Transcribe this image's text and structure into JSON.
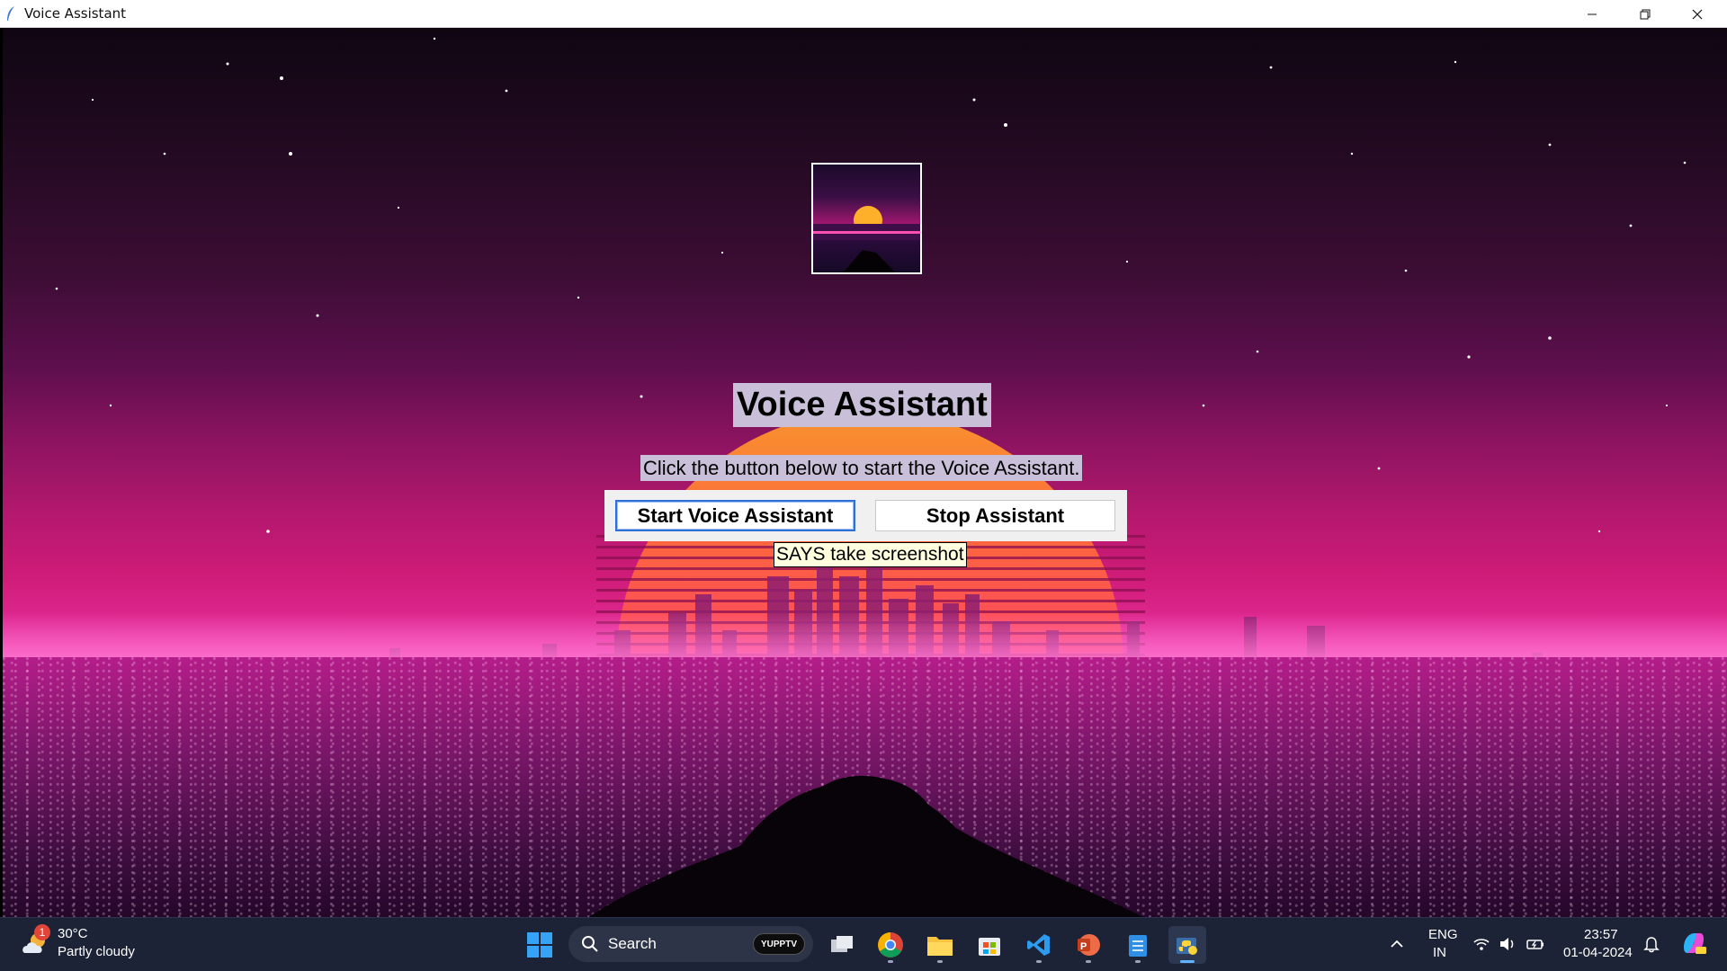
{
  "window": {
    "title": "Voice Assistant",
    "controls": [
      "minimize",
      "restore",
      "close"
    ]
  },
  "app": {
    "heading": "Voice Assistant",
    "subheading": "Click the button below to start the Voice Assistant.",
    "start_button": "Start Voice Assistant",
    "stop_button": "Stop Assistant",
    "status": "SAYS take screenshot"
  },
  "taskbar": {
    "weather": {
      "temp": "30°C",
      "condition": "Partly cloudy",
      "badge": "1"
    },
    "search_label": "Search",
    "search_badge": "YUPPTV",
    "apps": [
      "file-explorer-windows",
      "chrome",
      "file-explorer",
      "microsoft-store",
      "vs-code",
      "powerpoint",
      "notepad",
      "python"
    ],
    "active_app": "python",
    "language": {
      "line1": "ENG",
      "line2": "IN"
    },
    "time": "23:57",
    "date": "01-04-2024"
  },
  "colors": {
    "accent": "#2f6fd6",
    "label_bg": "#c9bfd9",
    "status_bg": "#ffffe0",
    "taskbar_bg": "#1c2336"
  }
}
